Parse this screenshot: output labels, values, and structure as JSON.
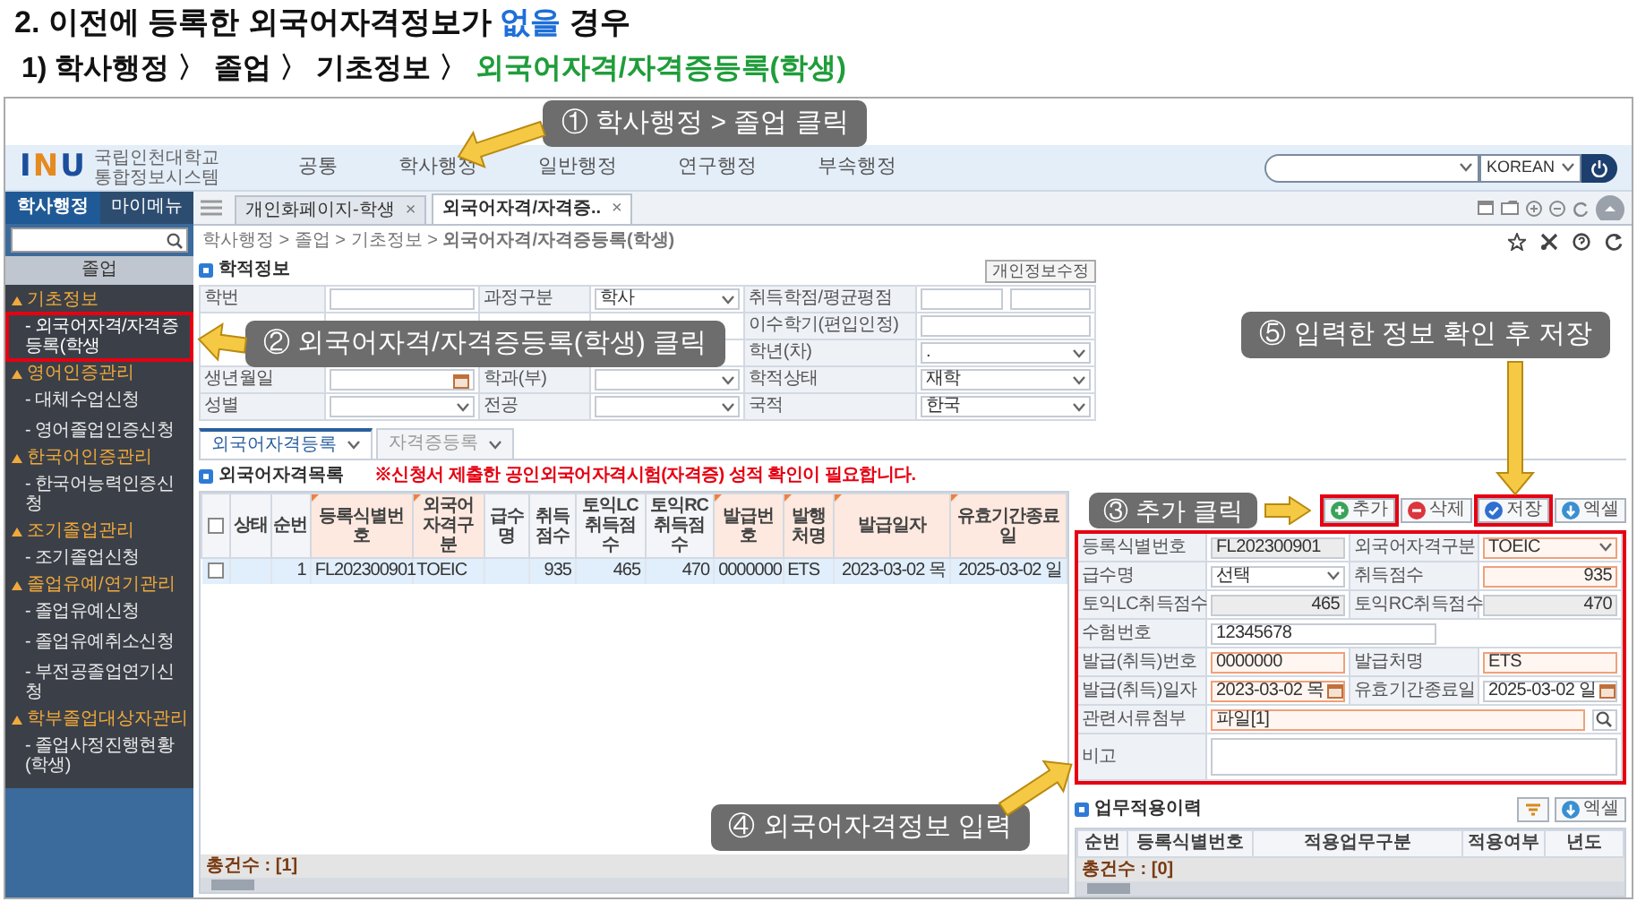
{
  "heading": {
    "parts": [
      {
        "text": "2. 이전에 등록한 외국어자격정보가",
        "color": "#111111"
      },
      {
        "text": "없을",
        "color": "#1f6fd8"
      },
      {
        "text": "경우",
        "color": "#111111"
      }
    ]
  },
  "subheading": {
    "parts": [
      {
        "text": "1) 학사행정 〉 졸업 〉 기초정보 〉",
        "color": "#111111"
      },
      {
        "text": "외국어자격/자격증등록(학생)",
        "color": "#1f9d3a"
      }
    ]
  },
  "app": {
    "logo_mark": "INU",
    "logo_lines": [
      "국립인천대학교",
      "통합정보시스템"
    ],
    "menu": [
      "공통",
      "학사행정",
      "일반행정",
      "연구행정",
      "부속행정"
    ],
    "language": "KOREAN",
    "sidebar": {
      "tabs": [
        {
          "label": "학사행정",
          "selected": true
        },
        {
          "label": "마이메뉴",
          "selected": false
        }
      ],
      "section": "졸업",
      "groups": [
        {
          "label": "기초정보",
          "children": [
            {
              "label": "- 외국어자격/자격증등록(학생",
              "selected": true,
              "highlighted": true
            }
          ]
        },
        {
          "label": "영어인증관리",
          "children": [
            {
              "label": "- 대체수업신청",
              "selected": false,
              "highlighted": false
            },
            {
              "label": "- 영어졸업인증신청",
              "selected": false,
              "highlighted": false
            }
          ]
        },
        {
          "label": "한국어인증관리",
          "children": [
            {
              "label": "- 한국어능력인증신청",
              "selected": false,
              "highlighted": false
            }
          ]
        },
        {
          "label": "조기졸업관리",
          "children": [
            {
              "label": "- 조기졸업신청",
              "selected": false,
              "highlighted": false
            }
          ]
        },
        {
          "label": "졸업유예/연기관리",
          "children": [
            {
              "label": "- 졸업유예신청",
              "selected": false,
              "highlighted": false
            },
            {
              "label": "- 졸업유예취소신청",
              "selected": false,
              "highlighted": false
            },
            {
              "label": "- 부전공졸업연기신청",
              "selected": false,
              "highlighted": false
            }
          ]
        },
        {
          "label": "학부졸업대상자관리",
          "children": [
            {
              "label": "- 졸업사정진행현황(학생)",
              "selected": false,
              "highlighted": false
            }
          ]
        }
      ]
    },
    "tabs": [
      {
        "label": "개인화페이지-학생",
        "close": "×",
        "selected": false
      },
      {
        "label": "외국어자격/자격증..",
        "close": "×",
        "selected": true
      }
    ],
    "breadcrumb": "학사행정 > 졸업 > 기초정보 > **외국어자격/자격증등록(학생)**",
    "student_info": {
      "title": "학적정보",
      "edit_button": "개인정보수정",
      "rows": [
        [
          {
            "label": "학번",
            "kind": "text"
          },
          {
            "label": "과정구분",
            "kind": "select",
            "value": "학사"
          },
          {
            "label": "취득학점/평균평점",
            "kind": "double"
          }
        ],
        [
          {
            "kind": "covered"
          },
          {
            "kind": "covered"
          },
          {
            "label": "이수학기(편입인정)",
            "kind": "text"
          }
        ],
        [
          {
            "kind": "covered"
          },
          {
            "kind": "covered"
          },
          {
            "label": "학년(차)",
            "kind": "select",
            "value": "."
          }
        ],
        [
          {
            "label": "생년월일",
            "kind": "date"
          },
          {
            "label": "학과(부)",
            "kind": "select"
          },
          {
            "label": "학적상태",
            "kind": "select",
            "value": "재학"
          }
        ],
        [
          {
            "label": "성별",
            "kind": "select"
          },
          {
            "label": "전공",
            "kind": "select"
          },
          {
            "label": "국적",
            "kind": "select",
            "value": "한국"
          }
        ]
      ]
    },
    "sub_tabs": [
      {
        "label": "외국어자격등록",
        "selected": true
      },
      {
        "label": "자격증등록",
        "selected": false
      }
    ],
    "list": {
      "title": "외국어자격목록",
      "notice": "※신청서 제출한 공인외국어자격시험(자격증) 성적 확인이 필요합니다.",
      "header_checked": false,
      "columns": [
        {
          "label": "상태",
          "kind": "text",
          "required": false
        },
        {
          "label": "순번",
          "kind": "number",
          "required": false
        },
        {
          "label": "등록식별번호",
          "kind": "code",
          "required": true
        },
        {
          "label": "외국어자격구분",
          "kind": "text",
          "required": true
        },
        {
          "label": "급수명",
          "kind": "text",
          "required": false
        },
        {
          "label": "취득점수",
          "kind": "number",
          "required": false
        },
        {
          "label": "토익LC 취득점수",
          "kind": "number",
          "required": false
        },
        {
          "label": "토익RC 취득점수",
          "kind": "number",
          "required": false
        },
        {
          "label": "발급번호",
          "kind": "text",
          "required": true
        },
        {
          "label": "발행처명",
          "kind": "text",
          "required": true
        },
        {
          "label": "발급일자",
          "kind": "number",
          "required": true
        },
        {
          "label": "유효기간종료일",
          "kind": "number",
          "required": true
        }
      ],
      "rows": [
        {
          "checked": false,
          "selected": true,
          "cells": [
            null,
            "1",
            "FL202300901",
            "TOEIC",
            null,
            "935",
            "465",
            "470",
            "0000000",
            "ETS",
            "2023-03-02 목",
            "2025-03-02 일"
          ]
        }
      ],
      "total": "총건수 : [1]"
    },
    "buttons": [
      {
        "kind": "add",
        "label": "추가",
        "highlighted": true
      },
      {
        "kind": "delete",
        "label": "삭제",
        "highlighted": false
      },
      {
        "kind": "save",
        "label": "저장",
        "highlighted": true
      },
      {
        "kind": "excel",
        "label": "엑셀",
        "highlighted": false
      }
    ],
    "detail": {
      "highlighted": true,
      "rows": [
        [
          {
            "label": "등록식별번호",
            "kind": "text",
            "value": "FL202300901",
            "readonly": true
          },
          {
            "label": "외국어자격구분",
            "kind": "select",
            "value": "TOEIC",
            "required": true
          }
        ],
        [
          {
            "label": "급수명",
            "kind": "select",
            "value": "선택"
          },
          {
            "label": "취득점수",
            "kind": "number",
            "value": "935",
            "required": true
          }
        ],
        [
          {
            "label": "토익LC취득점수",
            "kind": "number",
            "value": "465",
            "readonly": true
          },
          {
            "label": "토익RC취득점수",
            "kind": "number",
            "value": "470",
            "readonly": true
          }
        ],
        [
          {
            "label": "수험번호",
            "kind": "text",
            "value": "12345678"
          }
        ],
        [
          {
            "label": "발급(취득)번호",
            "kind": "text",
            "value": "0000000",
            "required": true
          },
          {
            "label": "발급처명",
            "kind": "text",
            "value": "ETS",
            "required": true
          }
        ],
        [
          {
            "label": "발급(취득)일자",
            "kind": "date",
            "value": "2023-03-02 목",
            "required": true
          },
          {
            "label": "유효기간종료일",
            "kind": "date",
            "value": "2025-03-02 일"
          }
        ],
        [
          {
            "label": "관련서류첨부",
            "kind": "file",
            "value": "파일[1]",
            "required": true
          }
        ],
        [
          {
            "label": "비고",
            "kind": "textarea"
          }
        ]
      ]
    },
    "history": {
      "title": "업무적용이력",
      "excel_button": "엑셀",
      "columns": [
        "순번",
        "등록식별번호",
        "적용업무구분",
        "적용여부",
        "년도"
      ],
      "total": "총건수 : [0]"
    }
  },
  "callouts": [
    {
      "text": "① 학사행정 > 졸업 클릭",
      "kind": "menu"
    },
    {
      "text": "② 외국어자격/자격증등록(학생) 클릭",
      "kind": "sidebar"
    },
    {
      "text": "③ 추가 클릭",
      "kind": "add"
    },
    {
      "text": "④ 외국어자격정보 입력",
      "kind": "detail"
    },
    {
      "text": "⑤ 입력한 정보 확인 후 저장",
      "kind": "save"
    }
  ]
}
